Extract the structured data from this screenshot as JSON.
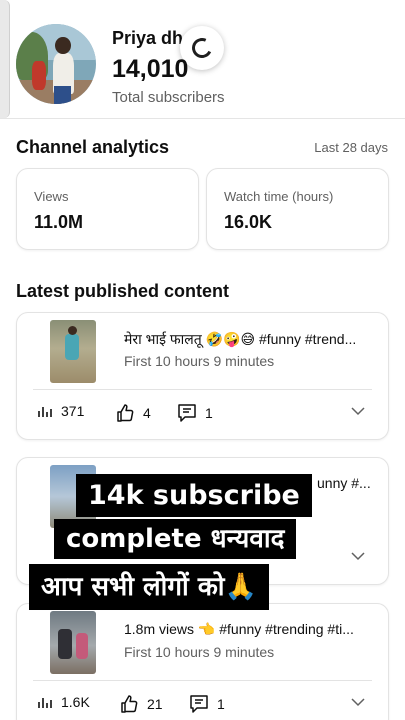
{
  "header": {
    "channel_name": "Priya dha",
    "subscriber_count": "14,010",
    "subscriber_label": "Total subscribers"
  },
  "analytics": {
    "title": "Channel analytics",
    "range": "Last 28 days",
    "metrics": [
      {
        "label": "Views",
        "value": "11.0M"
      },
      {
        "label": "Watch time (hours)",
        "value": "16.0K"
      }
    ]
  },
  "content": {
    "title": "Latest published content",
    "videos": [
      {
        "title": "मेरा भाई फालतू 🤣🤪😅 #funny #trend...",
        "subtitle": "First 10 hours 9 minutes",
        "views": "371",
        "likes": "4",
        "comments": "1"
      },
      {
        "title": "unny #...",
        "subtitle": "",
        "views": "",
        "likes": "",
        "comments": ""
      },
      {
        "title": "1.8m views 👈 #funny #trending #ti...",
        "subtitle": "First 10 hours 9 minutes",
        "views": "1.6K",
        "likes": "21",
        "comments": "1"
      }
    ]
  },
  "overlay": {
    "line1": "14k subscribe",
    "line2": "complete धन्यवाद",
    "line3": "आप सभी लोगों को🙏"
  },
  "icons": [
    "spinner-icon",
    "views-icon",
    "like-icon",
    "comment-icon",
    "chevron-down-icon"
  ]
}
